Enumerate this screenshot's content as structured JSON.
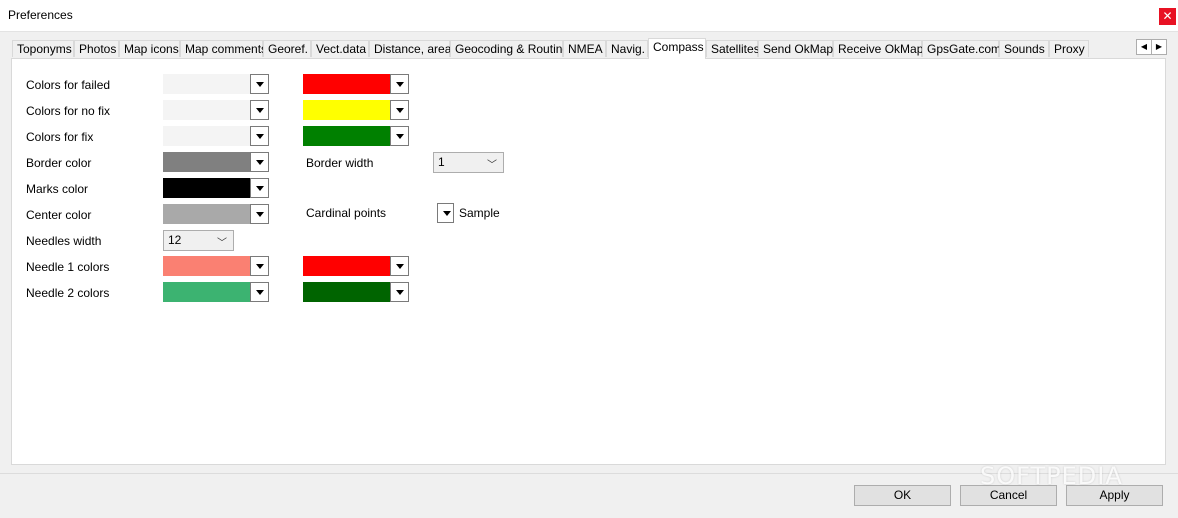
{
  "window": {
    "title": "Preferences"
  },
  "tabs": [
    {
      "label": "Toponyms"
    },
    {
      "label": "Photos"
    },
    {
      "label": "Map icons"
    },
    {
      "label": "Map comments"
    },
    {
      "label": "Georef."
    },
    {
      "label": "Vect.data"
    },
    {
      "label": "Distance, area"
    },
    {
      "label": "Geocoding & Routing"
    },
    {
      "label": "NMEA"
    },
    {
      "label": "Navig."
    },
    {
      "label": "Compass"
    },
    {
      "label": "Satellites"
    },
    {
      "label": "Send OkMap"
    },
    {
      "label": "Receive OkMap"
    },
    {
      "label": "GpsGate.com"
    },
    {
      "label": "Sounds"
    },
    {
      "label": "Proxy"
    }
  ],
  "active_tab": "Compass",
  "compass": {
    "colors_failed_label": "Colors for failed",
    "colors_nofix_label": "Colors for no fix",
    "colors_fix_label": "Colors for fix",
    "border_color_label": "Border color",
    "marks_color_label": "Marks color",
    "center_color_label": "Center color",
    "needles_width_label": "Needles width",
    "needles_width_value": "12",
    "needle1_label": "Needle 1 colors",
    "needle2_label": "Needle 2 colors",
    "border_width_label": "Border width",
    "border_width_value": "1",
    "cardinal_points_label": "Cardinal points",
    "sample_label": "Sample",
    "colors": {
      "failed_1": "#f4f4f4",
      "failed_2": "#ff0000",
      "nofix_1": "#f4f4f4",
      "nofix_2": "#ffff00",
      "fix_1": "#f4f4f4",
      "fix_2": "#008000",
      "border": "#808080",
      "marks": "#000000",
      "center": "#a9a9a9",
      "needle1_1": "#fa8072",
      "needle1_2": "#ff0000",
      "needle2_1": "#3cb371",
      "needle2_2": "#006400"
    }
  },
  "footer": {
    "ok_label": "OK",
    "cancel_label": "Cancel",
    "apply_label": "Apply"
  },
  "watermark": "SOFTPEDIA"
}
